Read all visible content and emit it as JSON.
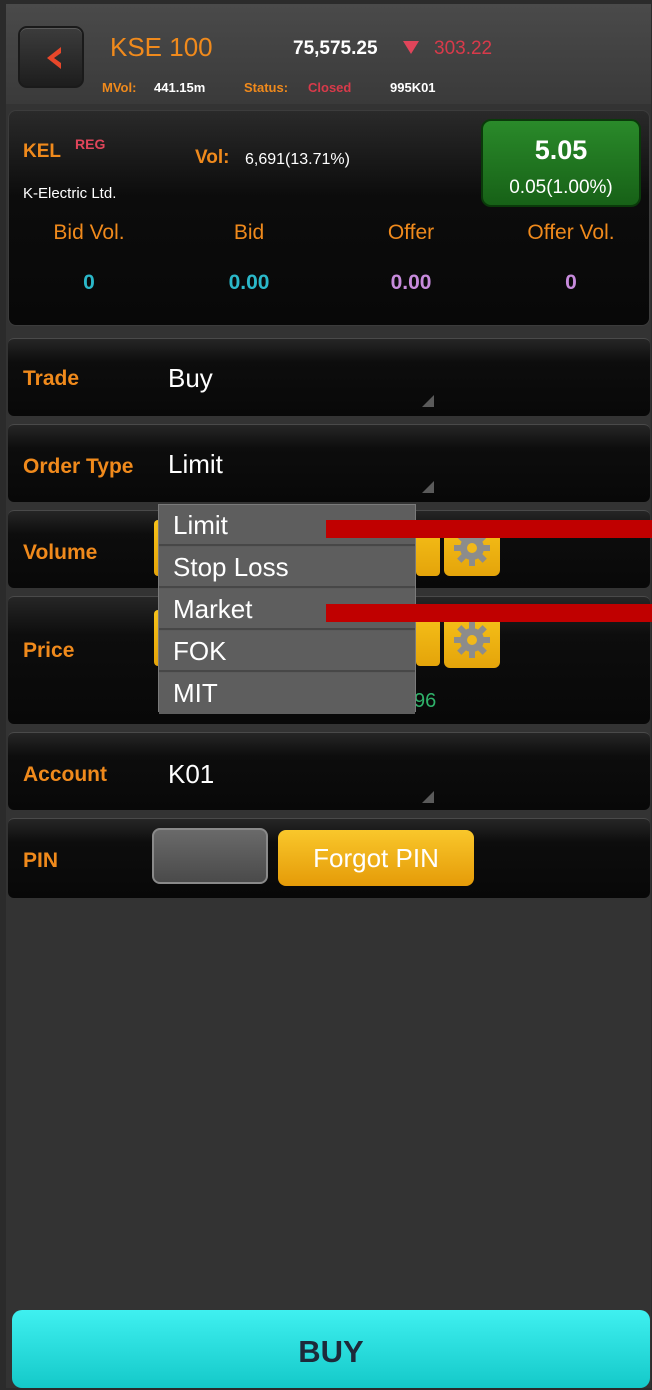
{
  "header": {
    "index_name": "KSE 100",
    "index_value": "75,575.25",
    "index_change": "303.22",
    "mval_label": "MVol:",
    "mval_value": "441.15m",
    "status_label": "Status:",
    "status_value": "Closed",
    "account_code": "995K01"
  },
  "quote": {
    "symbol": "KEL",
    "symbol_tag": "REG",
    "company": "K-Electric Ltd.",
    "vol_label": "Vol:",
    "vol_value": "6,691(13.71%)",
    "price": "5.05",
    "change": "0.05(1.00%)",
    "columns": [
      {
        "label": "Bid Vol.",
        "value": "0"
      },
      {
        "label": "Bid",
        "value": "0.00"
      },
      {
        "label": "Offer",
        "value": "0.00"
      },
      {
        "label": "Offer Vol.",
        "value": "0"
      }
    ]
  },
  "form": {
    "trade_label": "Trade",
    "trade_value": "Buy",
    "order_type_label": "Order Type",
    "order_type_value": "Limit",
    "volume_label": "Volume",
    "price_label": "Price",
    "price_hint": "96",
    "account_label": "Account",
    "account_value": "K01",
    "pin_label": "PIN",
    "forgot_pin": "Forgot PIN"
  },
  "dropdown": {
    "options": [
      "Limit",
      "Stop Loss",
      "Market",
      "FOK",
      "MIT"
    ]
  },
  "buy_button": "BUY",
  "colors": {
    "accent": "#f08a1c",
    "down": "#d83a4a",
    "positive": "#1f7a1f",
    "buy": "#1fdcdc"
  }
}
